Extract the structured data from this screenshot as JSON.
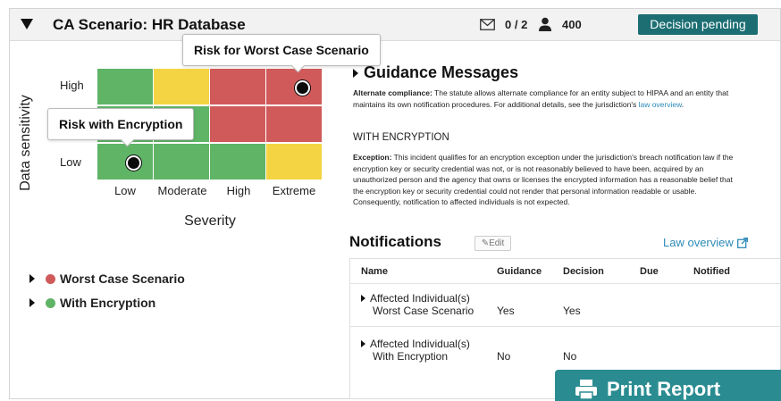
{
  "header": {
    "title": "CA Scenario: HR Database",
    "messages": "0 / 2",
    "users": "400",
    "status": "Decision pending",
    "status_color": "#1c6e73"
  },
  "matrix": {
    "ylabel": "Data sensitivity",
    "y_ticks": [
      "High",
      "Low"
    ],
    "xlabel": "Severity",
    "x_ticks": [
      "Low",
      "Moderate",
      "High",
      "Extreme"
    ],
    "colors": {
      "green": "#5fb466",
      "yellow": "#f5d443",
      "red": "#d05a5a"
    },
    "callout_worst": "Risk for Worst Case Scenario",
    "callout_encryption": "Risk with Encryption"
  },
  "legend": [
    {
      "label": "Worst Case Scenario",
      "color": "#d05a5a"
    },
    {
      "label": "With Encryption",
      "color": "#5fb466"
    }
  ],
  "guidance": {
    "title": "Guidance Messages",
    "p1_bold": "Alternate compliance:",
    "p1_text": " The statute allows alternate compliance for an entity subject to HIPAA and an entity that maintains its own notification procedures. For additional details, see the jurisdiction's ",
    "p1_link": "law overview",
    "p1_end": ".",
    "subhead": "WITH ENCRYPTION",
    "p2_bold": "Exception:",
    "p2_text": " This incident qualifies for an encryption exception under the jurisdiction's breach notification law if the encryption key or security credential was not, or is not reasonably believed to have been, acquired by an unauthorized person and the agency that owns or licenses the encrypted information has a reasonable belief that the encryption key or security credential could not render that personal information readable or usable. Consequently, notification to affected individuals is not expected."
  },
  "notifications": {
    "title": "Notifications",
    "edit": "Edit",
    "law_overview": "Law overview",
    "columns": [
      "Name",
      "Guidance",
      "Decision",
      "Due",
      "Notified"
    ],
    "rows": [
      {
        "name1": "Affected Individual(s)",
        "name2": "Worst Case Scenario",
        "guidance": "Yes",
        "decision": "Yes",
        "due": "",
        "notified": ""
      },
      {
        "name1": "Affected Individual(s)",
        "name2": "With Encryption",
        "guidance": "No",
        "decision": "No",
        "due": "",
        "notified": ""
      }
    ]
  },
  "print_button": "Print Report"
}
